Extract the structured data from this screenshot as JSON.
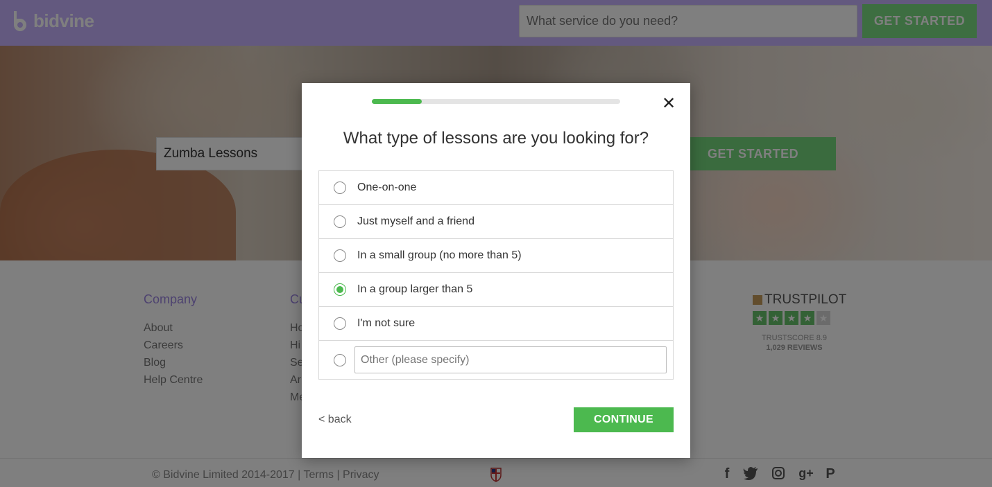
{
  "header": {
    "logo_text": "bidvine",
    "search_placeholder": "What service do you need?",
    "cta_label": "GET STARTED"
  },
  "hero": {
    "search_value": "Zumba Lessons",
    "cta_label": "GET STARTED"
  },
  "footer": {
    "columns": [
      {
        "title": "Company",
        "links": [
          "About",
          "Careers",
          "Blog",
          "Help Centre"
        ]
      },
      {
        "title": "Cu",
        "links": [
          "Ho",
          "Hi",
          "Se",
          "Ar",
          "Me"
        ]
      }
    ],
    "trustpilot": {
      "name": "TRUSTPILOT",
      "stars_filled": 4,
      "stars_total": 5,
      "score_label": "TRUSTSCORE 8.9",
      "reviews_label": "1,029 REVIEWS"
    },
    "copyright": "©  Bidvine Limited 2014-2017 | Terms | Privacy",
    "social_icons": [
      "facebook-icon",
      "twitter-icon",
      "instagram-icon",
      "google-plus-icon",
      "pinterest-icon"
    ]
  },
  "modal": {
    "progress": 0.2,
    "title": "What type of lessons are you looking for?",
    "options": [
      {
        "label": "One-on-one",
        "selected": false
      },
      {
        "label": "Just myself and a friend",
        "selected": false
      },
      {
        "label": "In a small group (no more than 5)",
        "selected": false
      },
      {
        "label": "In a group larger than 5",
        "selected": true
      },
      {
        "label": "I'm not sure",
        "selected": false
      }
    ],
    "other_placeholder": "Other (please specify)",
    "back_label": "< back",
    "continue_label": "CONTINUE"
  },
  "colors": {
    "header_bg": "#c7b3ff",
    "brand_green": "#4cb94f",
    "footer_title": "#9b84e0"
  }
}
